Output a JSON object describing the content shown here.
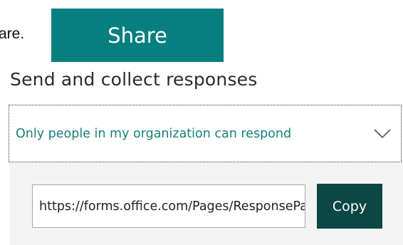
{
  "intro": {
    "text": "are."
  },
  "share": {
    "label": "Share"
  },
  "send": {
    "title": "Send and collect responses",
    "access": {
      "selected": "Only people in my organization can respond",
      "icon": "chevron-down-icon"
    },
    "link": {
      "value": "https://forms.office.com/Pages/ResponsePage.aspx"
    },
    "copy_label": "Copy"
  },
  "colors": {
    "share_bg": "#077f7f",
    "copy_bg": "#0b4747",
    "accent_text": "#16807b",
    "panel_bg": "#f3f3f3"
  }
}
